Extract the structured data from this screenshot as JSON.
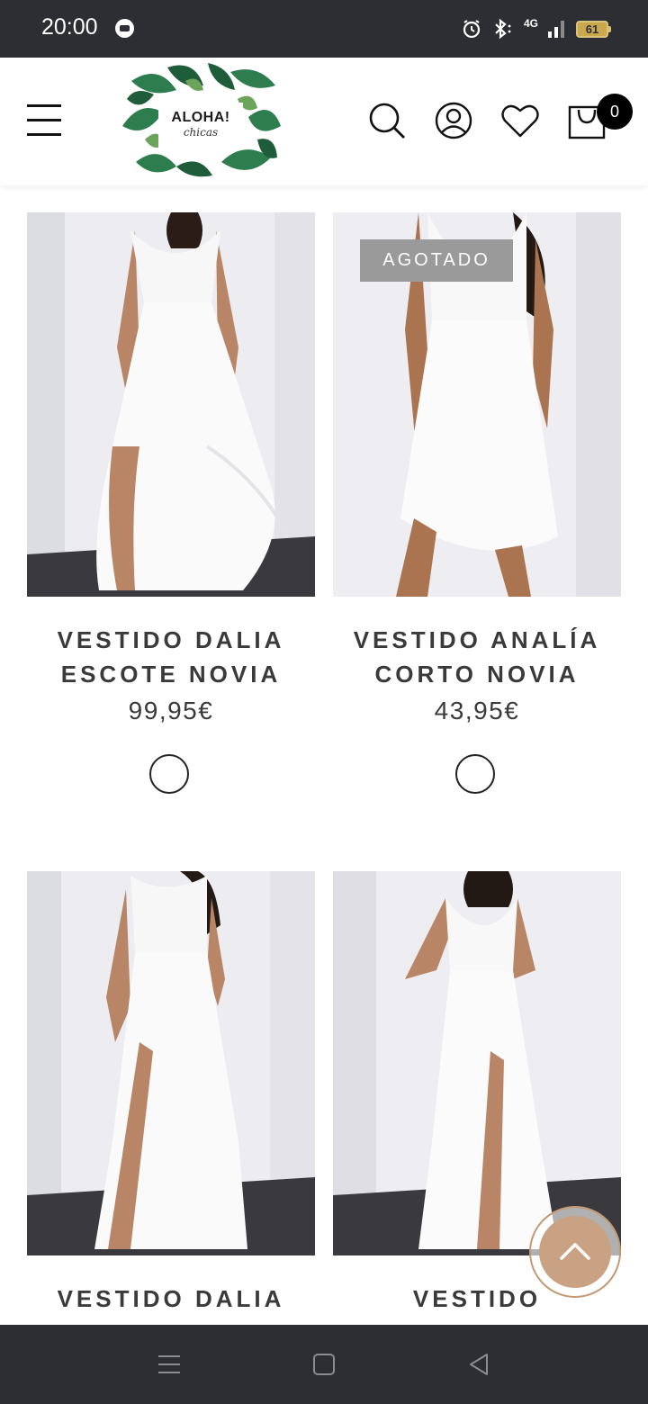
{
  "status_bar": {
    "time": "20:00",
    "network": "4G",
    "battery": "61"
  },
  "header": {
    "logo": {
      "line1": "ALOHA!",
      "line2": "chicas"
    },
    "cart_count": "0",
    "icons": [
      "menu-icon",
      "search-icon",
      "account-icon",
      "heart-icon",
      "cart-icon"
    ]
  },
  "products": [
    {
      "name_line1": "VESTIDO DALIA",
      "name_line2": "ESCOTE NOVIA",
      "price": "99,95€",
      "badge": "",
      "swatch_color": "#ffffff"
    },
    {
      "name_line1": "VESTIDO ANALÍA",
      "name_line2": "CORTO NOVIA",
      "price": "43,95€",
      "badge": "AGOTADO",
      "swatch_color": "#ffffff"
    },
    {
      "name_line1": "VESTIDO DALIA",
      "name_line2": "",
      "price": "",
      "badge": "",
      "swatch_color": "#ffffff"
    },
    {
      "name_line1": "VESTIDO",
      "name_line2": "",
      "price": "",
      "badge": "",
      "swatch_color": "#ffffff"
    }
  ],
  "colors": {
    "accent": "#c9a283",
    "status_bar": "#2d2e33",
    "text": "#3a3a3a",
    "badge": "#9a9a9a"
  }
}
